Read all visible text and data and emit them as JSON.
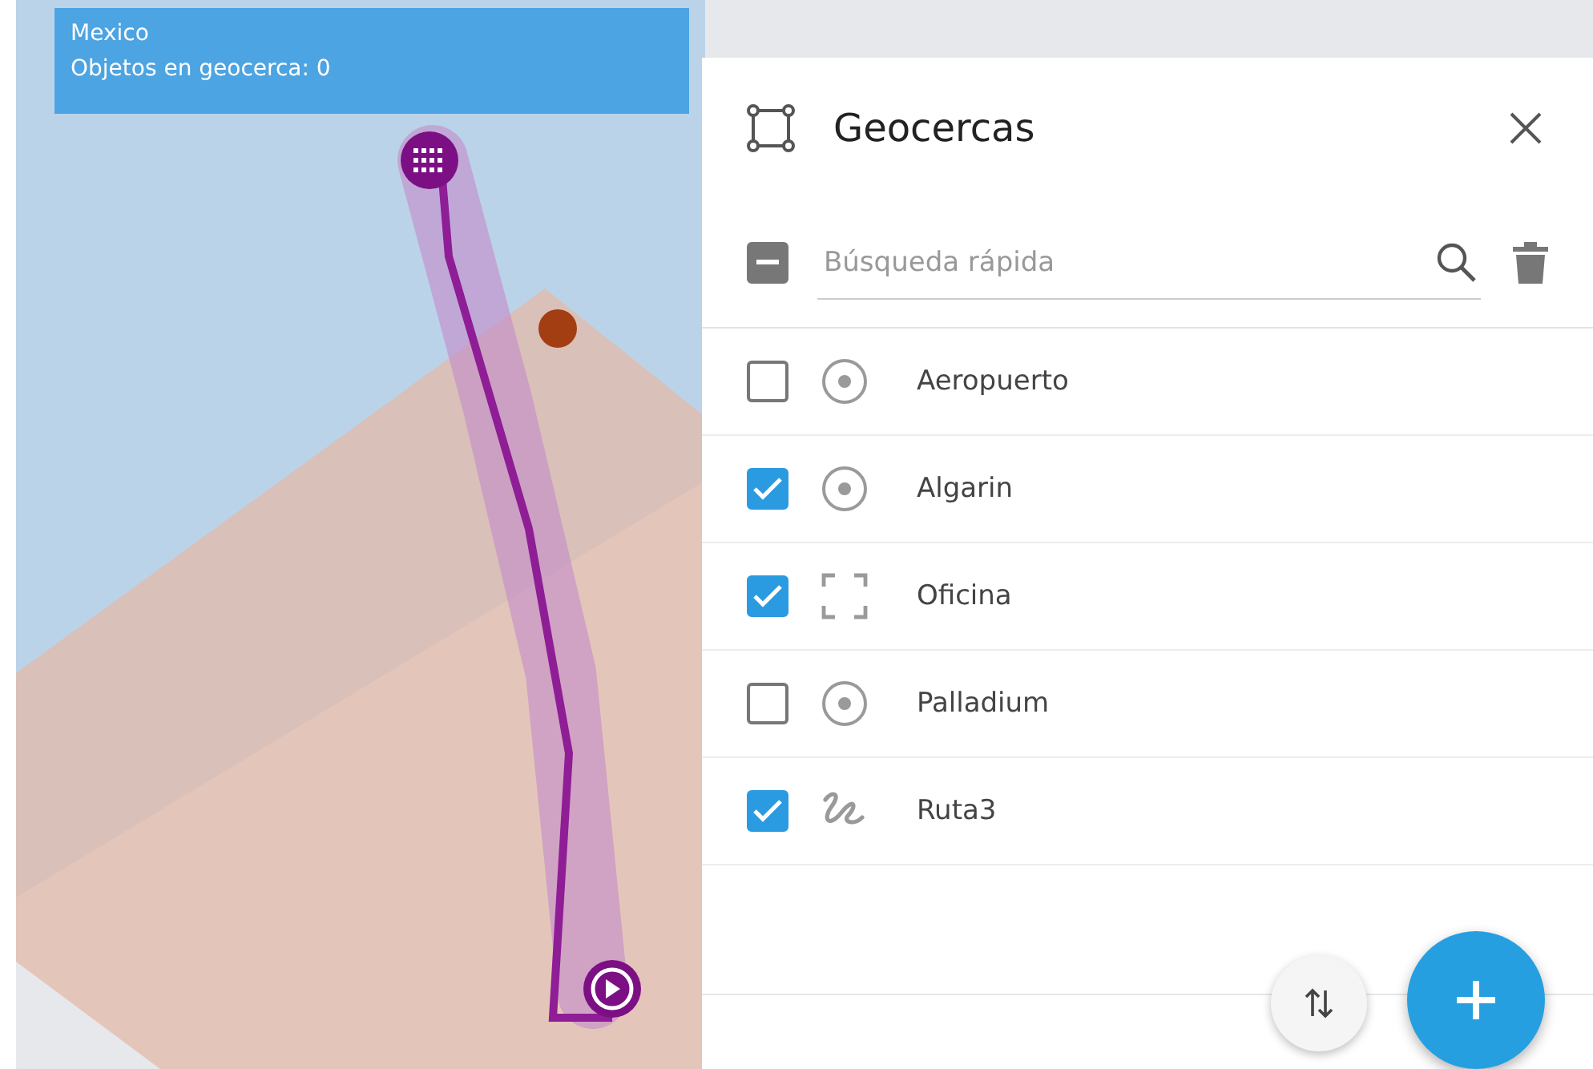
{
  "map_overlay": {
    "title": "Mexico",
    "count_label": "Objetos en geocerca: 0"
  },
  "panel": {
    "title": "Geocercas",
    "select_all": {
      "indeterminate": true
    },
    "search": {
      "placeholder": "Búsqueda rápida"
    },
    "geofences": [
      {
        "name": "Aeropuerto",
        "checked": false,
        "kind": "circle"
      },
      {
        "name": "Algarin",
        "checked": true,
        "kind": "circle"
      },
      {
        "name": "Oficina",
        "checked": true,
        "kind": "rectangle"
      },
      {
        "name": "Palladium",
        "checked": false,
        "kind": "circle"
      },
      {
        "name": "Ruta3",
        "checked": true,
        "kind": "route"
      }
    ]
  }
}
